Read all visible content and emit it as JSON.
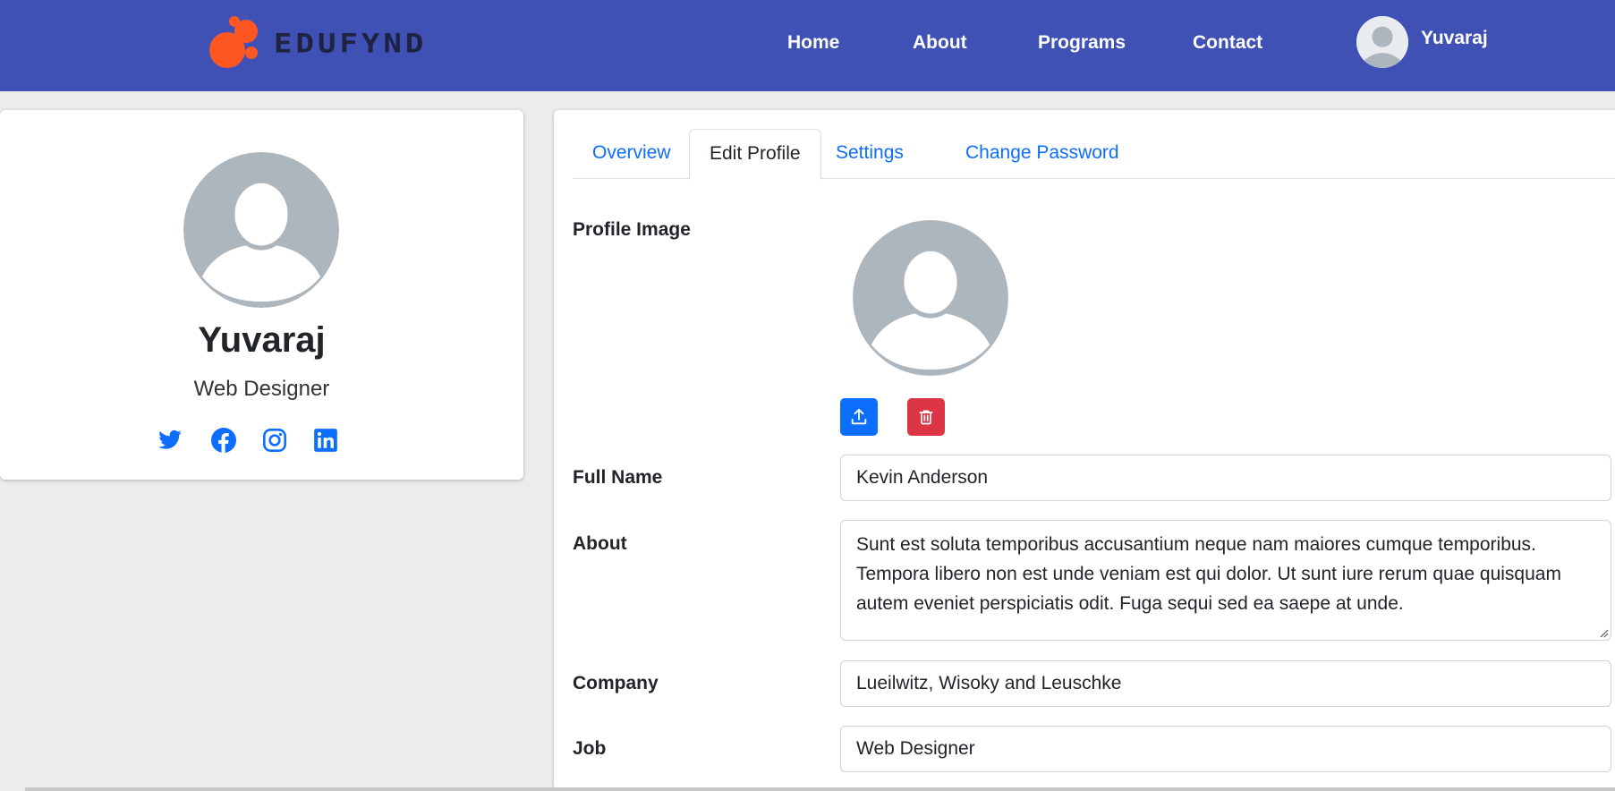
{
  "brand": {
    "logo_text": "EDUFYND",
    "accent": "#ff5722",
    "navbar_color": "#3f51b5"
  },
  "nav": {
    "home": "Home",
    "about": "About",
    "programs": "Programs",
    "contact": "Contact",
    "user_name": "Yuvaraj"
  },
  "profile": {
    "name": "Yuvaraj",
    "job": "Web Designer",
    "socials": [
      "twitter-icon",
      "facebook-icon",
      "instagram-icon",
      "linkedin-icon"
    ]
  },
  "tabs": {
    "overview": "Overview",
    "edit_profile": "Edit Profile",
    "settings": "Settings",
    "change_password": "Change Password",
    "active": "Edit Profile"
  },
  "form": {
    "profile_image_label": "Profile Image",
    "full_name_label": "Full Name",
    "full_name_value": "Kevin Anderson",
    "about_label": "About",
    "about_value": "Sunt est soluta temporibus accusantium neque nam maiores cumque temporibus. Tempora libero non est unde veniam est qui dolor. Ut sunt iure rerum quae quisquam autem eveniet perspiciatis odit. Fuga sequi sed ea saepe at unde.",
    "company_label": "Company",
    "company_value": "Lueilwitz, Wisoky and Leuschke",
    "job_label": "Job",
    "job_value": "Web Designer"
  }
}
